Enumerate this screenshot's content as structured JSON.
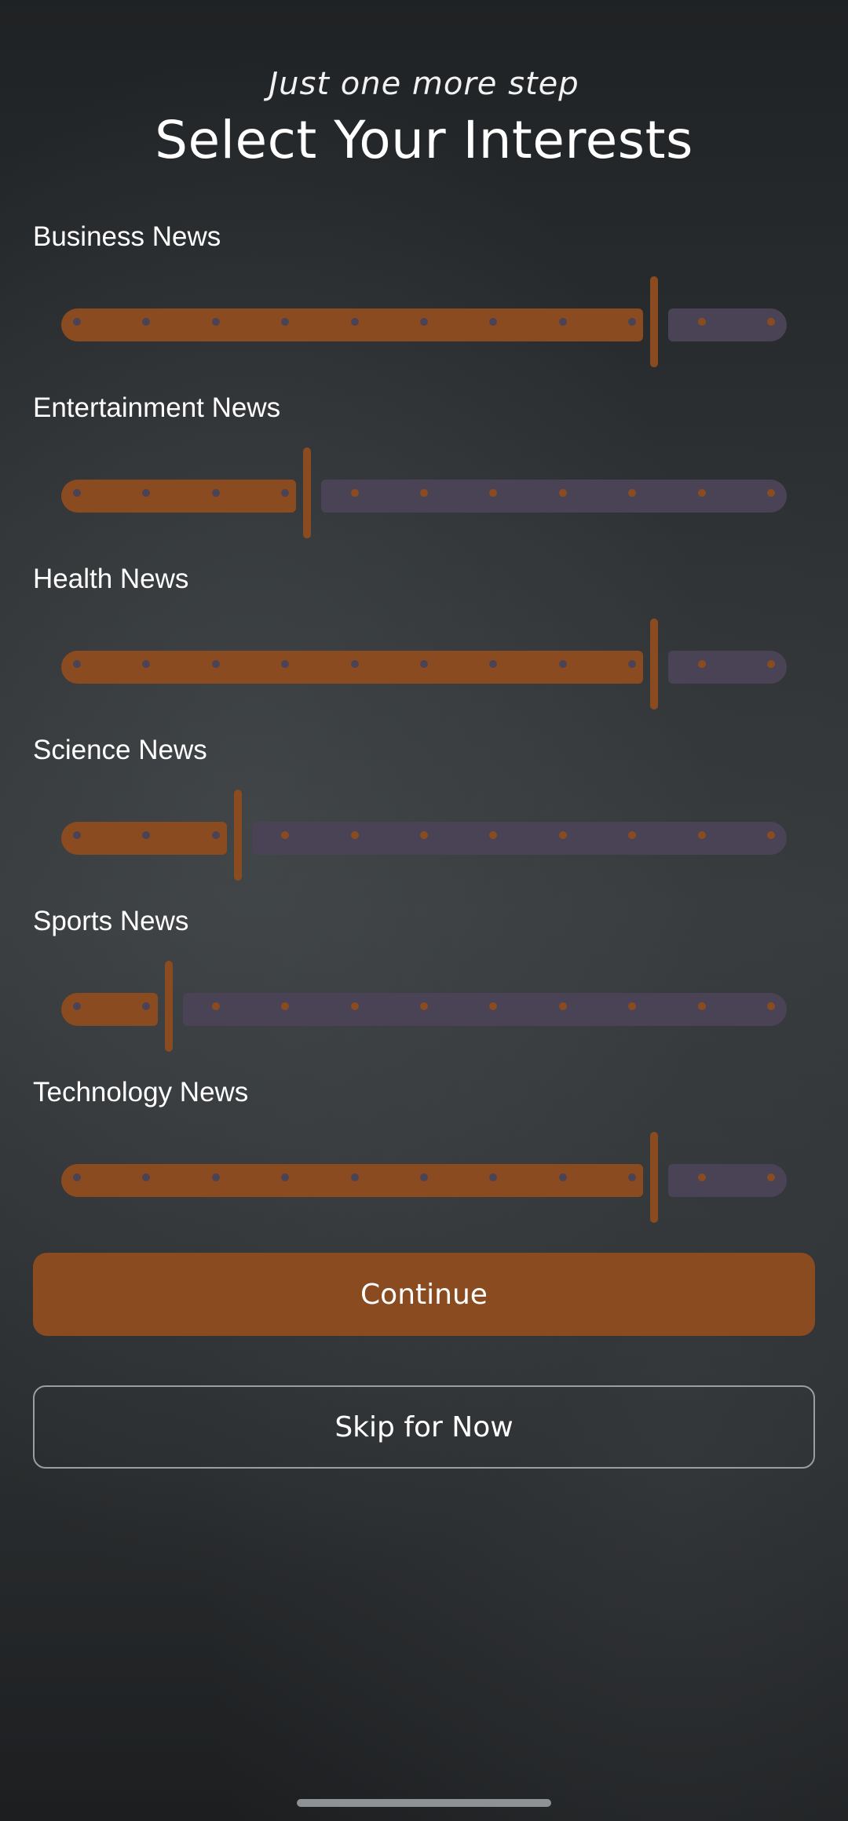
{
  "header": {
    "subtitle": "Just one more step",
    "title": "Select Your Interests"
  },
  "interests": [
    {
      "label": "Business News",
      "value": 9
    },
    {
      "label": "Entertainment News",
      "value": 4
    },
    {
      "label": "Health News",
      "value": 9
    },
    {
      "label": "Science News",
      "value": 3
    },
    {
      "label": "Sports News",
      "value": 2
    },
    {
      "label": "Technology News",
      "value": 9
    }
  ],
  "slider": {
    "max": 11,
    "colors": {
      "filled": "#8a4b20",
      "empty": "#4a4355"
    }
  },
  "actions": {
    "continue_label": "Continue",
    "skip_label": "Skip for Now"
  }
}
